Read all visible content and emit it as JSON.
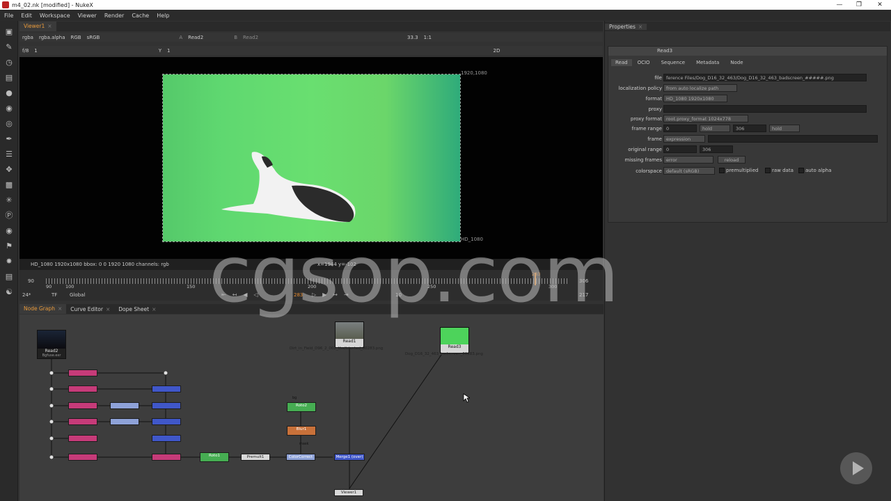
{
  "window": {
    "title": "m4_02.nk [modified] - NukeX"
  },
  "menu": [
    "File",
    "Edit",
    "Workspace",
    "Viewer",
    "Render",
    "Cache",
    "Help"
  ],
  "tool_icons": [
    "viewer-icon",
    "paint-icon",
    "clock-icon",
    "channel-icon",
    "color-icon",
    "keyer-icon",
    "filter-icon",
    "draw-icon",
    "merge-icon",
    "transform-icon",
    "3d-icon",
    "particles-icon",
    "deep-icon",
    "views-icon",
    "metadata-icon",
    "toolsets-icon",
    "other-icon",
    "help-icon"
  ],
  "viewer_tab": {
    "label": "Viewer1"
  },
  "viewer_bar": {
    "channels": "rgba",
    "alpha": "rgba.alpha",
    "display": "RGB",
    "lut": "sRGB",
    "a_input": "Read2",
    "b_input": "Read2",
    "b_label": "B",
    "a_label": "A",
    "frame_label": "f/8",
    "frame_value": "1",
    "y_label": "Y",
    "y_value": "1",
    "zoom": "33.3",
    "ratio": "1:1",
    "mode": "2D"
  },
  "viewer": {
    "top_right_label": "1920,1080",
    "format_label": "HD_1080",
    "info": "HD_1080 1920x1080  bbox: 0 0 1920 1080 channels: rgb",
    "coords": "x=1944 y=-102"
  },
  "timeline": {
    "start": "90",
    "end": "306",
    "ticks": [
      "90",
      "100",
      "150",
      "200",
      "250",
      "300",
      "306"
    ],
    "current_frame": "283",
    "fps": "24*",
    "tf": "TF",
    "scope": "Global",
    "step": "10",
    "out_frame": "217"
  },
  "graph_tabs": [
    "Node Graph",
    "Curve Editor",
    "Dope Sheet"
  ],
  "nodes": {
    "read2": {
      "label": "Read2",
      "sub": "Bgfuse.exr"
    },
    "read1": {
      "label": "Read1",
      "file": "Dirt_in_Field_D96_2_002_Undistorted_00283.png"
    },
    "read3": {
      "label": "Read3",
      "file": "Dog_D16_32_463_badscreen_00283.png"
    },
    "roto2": {
      "label": "Roto2",
      "sub": "(alpha)"
    },
    "blur1": {
      "label": "Blur1",
      "sub": "(all)"
    },
    "roto1": {
      "label": "Roto1",
      "sub": "(alpha)"
    },
    "premult": {
      "label": "Premult1"
    },
    "colorcorrect": {
      "label": "ColorCorrect"
    },
    "merge": {
      "label": "Merge1 (over)"
    },
    "viewer1": {
      "label": "Viewer1"
    },
    "mask_label": "mask",
    "bg_label": "bg",
    "a_label": "A",
    "one_label": "1"
  },
  "properties": {
    "tab": "Properties",
    "node_name": "Read3",
    "tabs": [
      "Read",
      "OCIO",
      "Sequence",
      "Metadata",
      "Node"
    ],
    "file_label": "file",
    "file_value": "ference Files/Dog_D16_32_463/Dog_D16_32_463_badscreen_#####.png",
    "localization_label": "localization policy",
    "localization_value": "from auto localize path",
    "format_label": "format",
    "format_value": "HD_1080 1920x1080",
    "proxy_label": "proxy",
    "proxy_format_label": "proxy format",
    "proxy_format_value": "root.proxy_format 1024x778",
    "frame_range_label": "frame range",
    "frame_range_start": "0",
    "frame_range_before": "hold",
    "frame_range_end": "306",
    "frame_range_after": "hold",
    "frame_label": "frame",
    "frame_value": "expression",
    "original_range_label": "original range",
    "original_range_start": "0",
    "original_range_end": "306",
    "missing_frames_label": "missing frames",
    "missing_frames_value": "error",
    "reload_label": "reload",
    "colorspace_label": "colorspace",
    "colorspace_value": "default (sRGB)",
    "premultiplied_label": "premultiplied",
    "raw_data_label": "raw data",
    "auto_alpha_label": "auto alpha"
  },
  "watermark": "cgsop.com"
}
